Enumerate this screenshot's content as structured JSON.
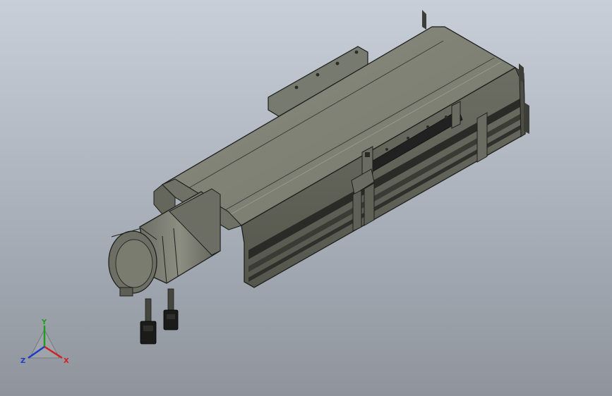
{
  "scene": {
    "model": "linear-actuator-module-with-servo-motor",
    "background_top": "#c9cfd8",
    "background_bottom": "#8f949c",
    "body_color": "#7d7f73",
    "edge_color": "#1e1f1c"
  },
  "triad": {
    "x_label": "X",
    "y_label": "Y",
    "z_label": "Z",
    "x_color": "#d42020",
    "y_color": "#1ea01e",
    "z_color": "#1e3cc8"
  }
}
